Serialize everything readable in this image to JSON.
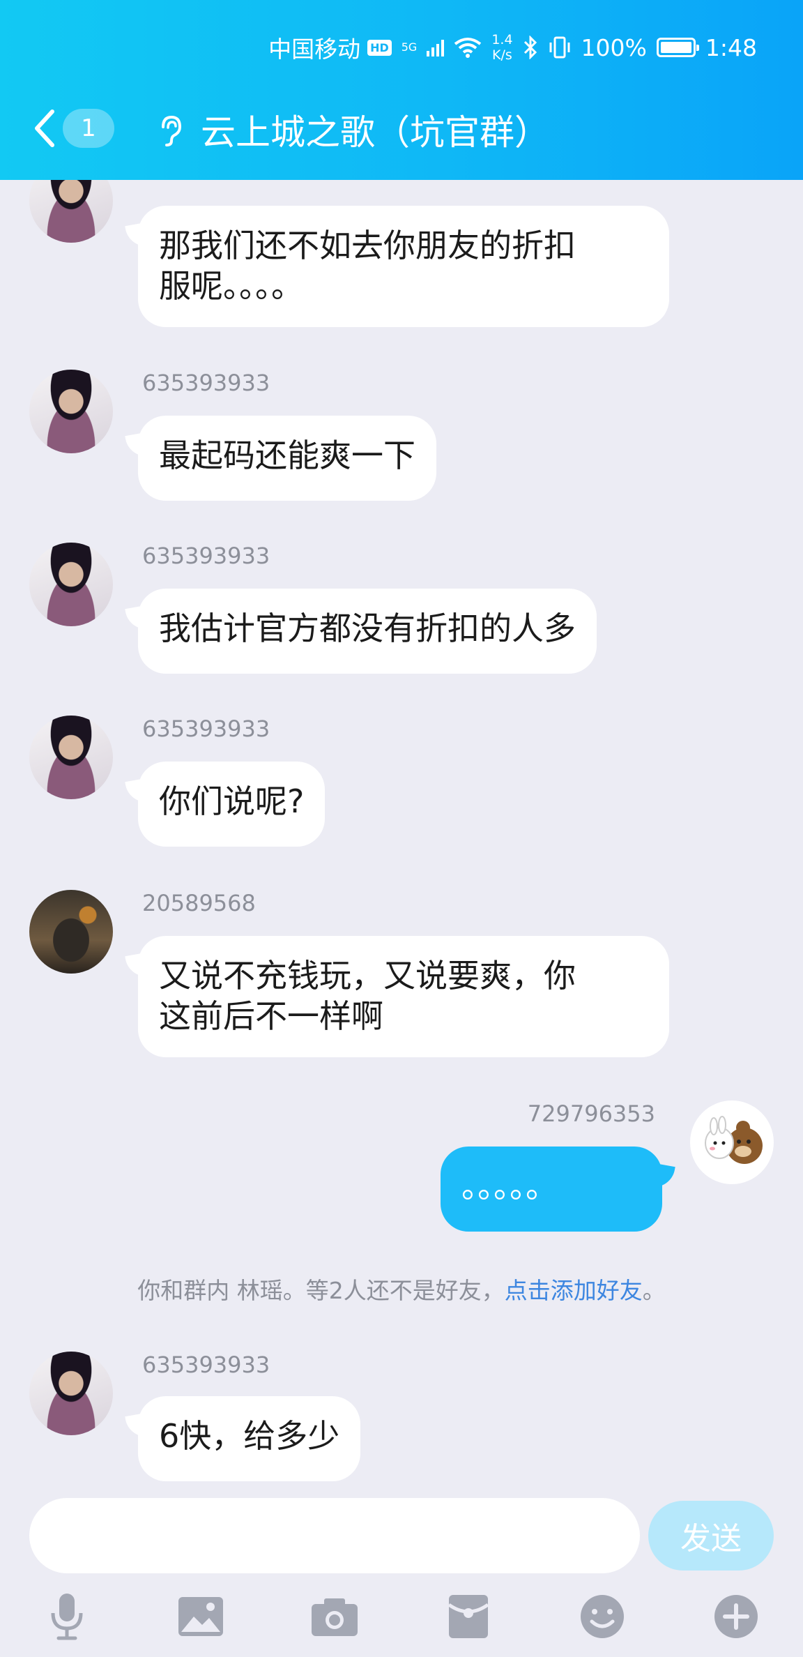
{
  "status_bar": {
    "carrier": "中国移动",
    "hd_tag": "HD",
    "net_gen": "5G",
    "net_speed_value": "1.4",
    "net_speed_unit": "K/s",
    "battery_percent": "100%",
    "time": "1:48"
  },
  "header": {
    "unread_count": "1",
    "title": "云上城之歌（坑官群）"
  },
  "messages": [
    {
      "sender": "",
      "text": "那我们还不如去你朋友的折扣\n服呢。。。。"
    },
    {
      "sender": "635393933",
      "text": "最起码还能爽一下"
    },
    {
      "sender": "635393933",
      "text": "我估计官方都没有折扣的人多"
    },
    {
      "sender": "635393933",
      "text": "你们说呢?"
    },
    {
      "sender": "20589568",
      "text": "又说不充钱玩，又说要爽，你\n这前后不一样啊"
    },
    {
      "sender": "729796353",
      "text": "。。。。。"
    },
    {
      "sender": "635393933",
      "text": "6快，给多少"
    }
  ],
  "notice": {
    "text": "你和群内 林瑶。等2人还不是好友，",
    "link": "点击添加好友",
    "end": "。"
  },
  "input": {
    "placeholder": "",
    "send_label": "发送"
  },
  "colors": {
    "header_start": "#12c9f3",
    "header_end": "#0aa4f8",
    "my_bubble": "#1ebcf9",
    "send_disabled": "#b6e8fb",
    "link": "#3d86e0"
  },
  "icons": [
    "microphone-icon",
    "image-icon",
    "camera-icon",
    "red-packet-icon",
    "emoji-icon",
    "plus-icon"
  ]
}
